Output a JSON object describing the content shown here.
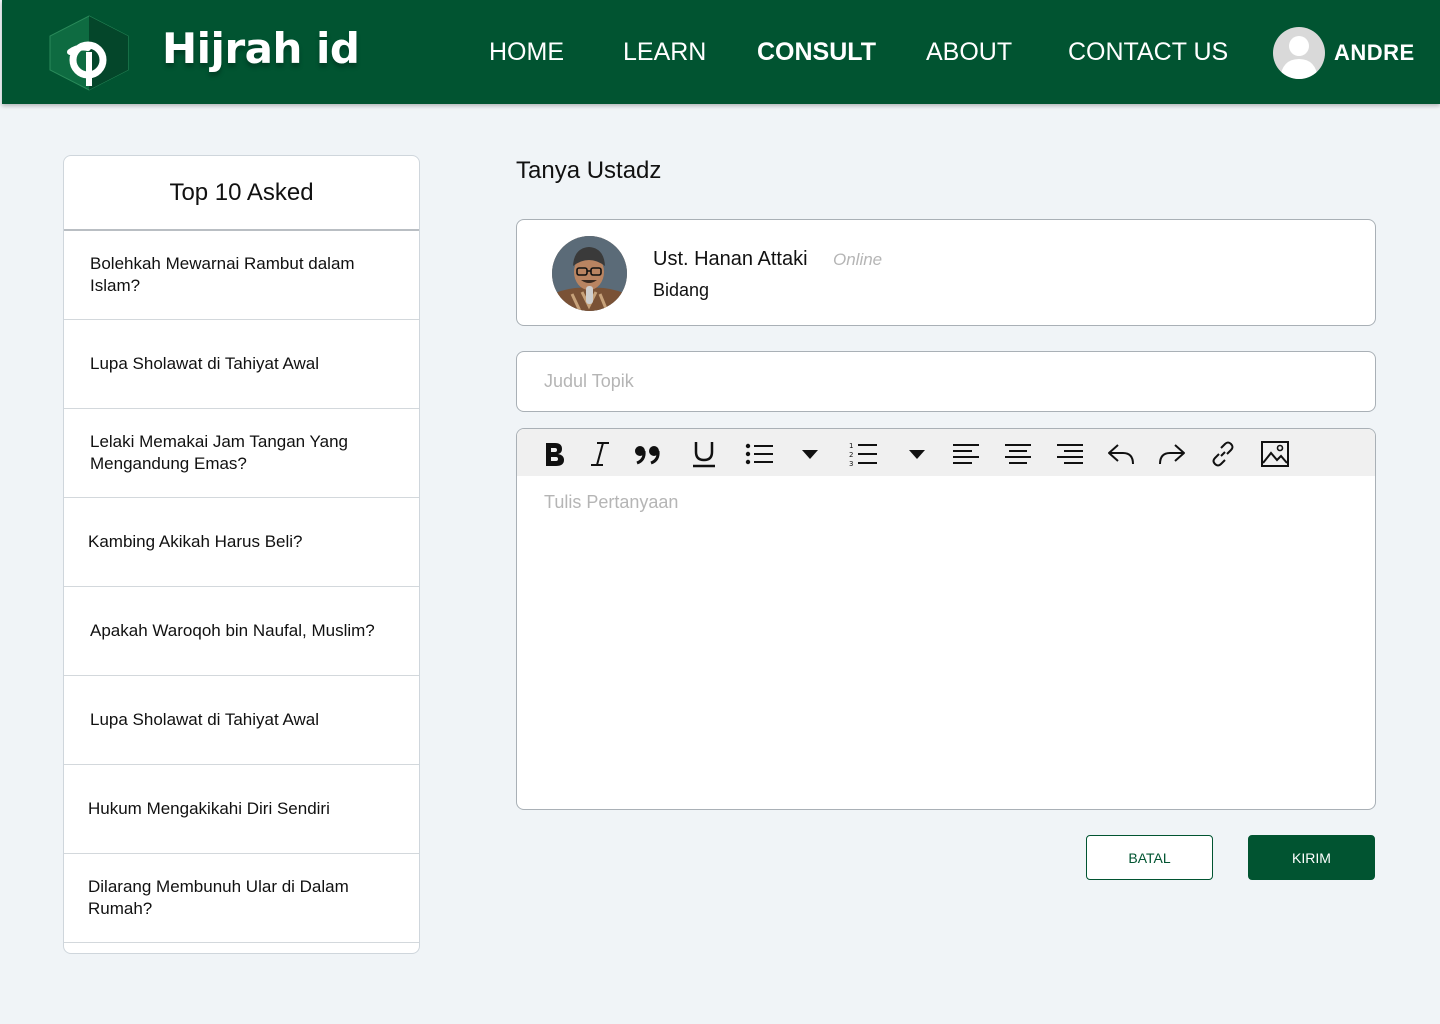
{
  "header": {
    "brand": "Hijrah id",
    "nav": [
      {
        "label": "HOME"
      },
      {
        "label": "LEARN"
      },
      {
        "label": "CONSULT"
      },
      {
        "label": "ABOUT"
      },
      {
        "label": "CONTACT US"
      }
    ],
    "active_nav": "CONSULT",
    "user": {
      "name": "ANDRE",
      "avatar_icon": "user-avatar-icon"
    },
    "background_color": "#015431"
  },
  "sidebar": {
    "title": "Top 10 Asked",
    "questions": [
      {
        "text": "Bolehkah Mewarnai Rambut dalam Islam?"
      },
      {
        "text": "Lupa Sholawat di Tahiyat Awal"
      },
      {
        "text": "Lelaki Memakai Jam Tangan Yang Mengandung Emas?"
      },
      {
        "text": "Kambing Akikah Harus Beli?"
      },
      {
        "text": "Apakah Waroqoh bin Naufal, Muslim?"
      },
      {
        "text": "Lupa Sholawat di Tahiyat Awal"
      },
      {
        "text": "Hukum Mengakikahi Diri Sendiri"
      },
      {
        "text": "Dilarang Membunuh Ular di Dalam Rumah?"
      }
    ]
  },
  "main": {
    "title": "Tanya Ustadz",
    "ustadz": {
      "name": "Ust. Hanan Attaki",
      "status": "Online",
      "field": "Bidang"
    },
    "topic": {
      "placeholder": "Judul Topik",
      "value": ""
    },
    "editor": {
      "placeholder": "Tulis Pertanyaan",
      "value": "",
      "toolbar": [
        "bold-icon",
        "italic-icon",
        "quote-icon",
        "underline-icon",
        "bullet-list-icon",
        "dropdown-icon",
        "numbered-list-icon",
        "dropdown-icon",
        "align-left-icon",
        "align-center-icon",
        "align-right-icon",
        "undo-icon",
        "redo-icon",
        "link-icon",
        "image-icon"
      ]
    },
    "buttons": {
      "cancel": "BATAL",
      "send": "KIRIM"
    }
  }
}
